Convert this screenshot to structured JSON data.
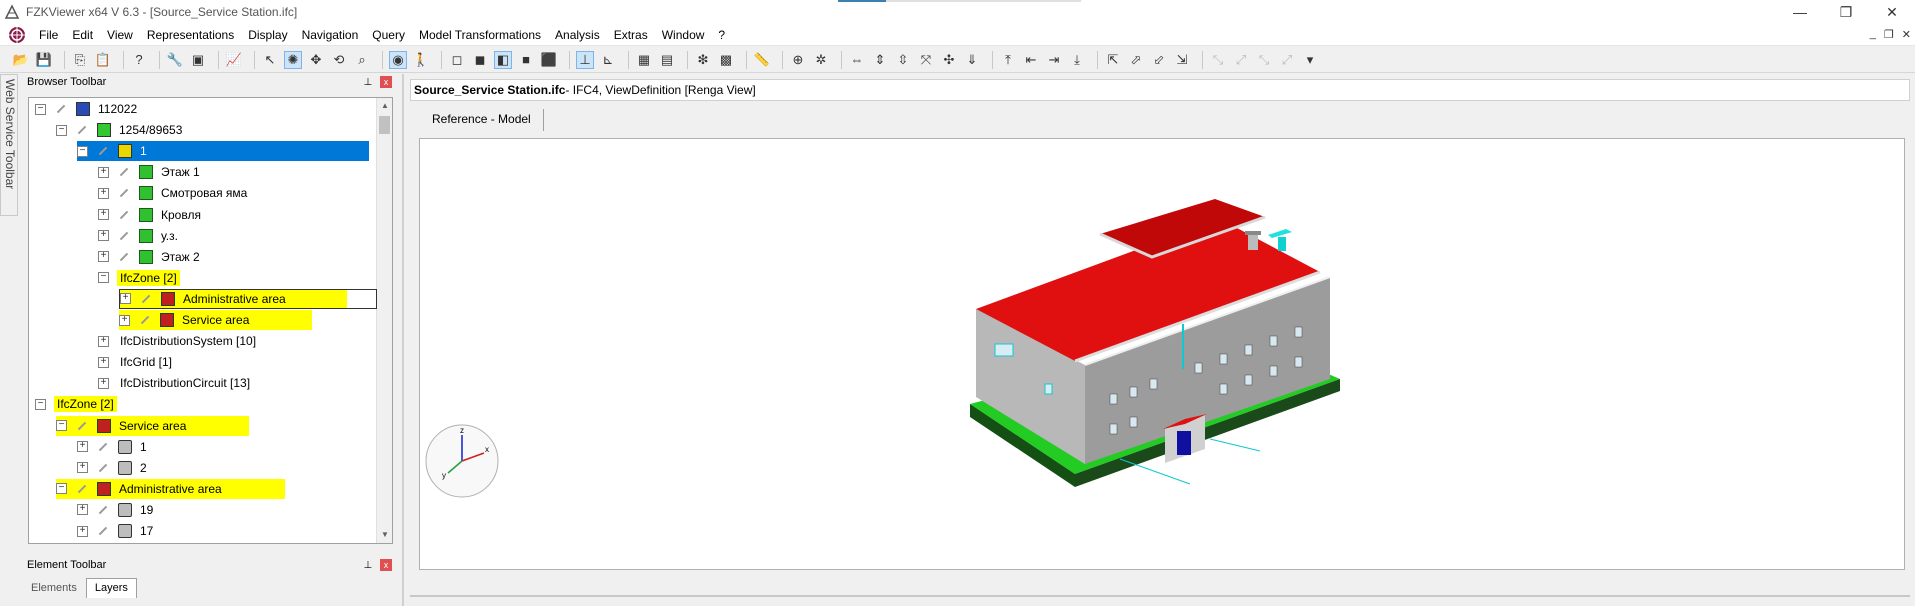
{
  "window": {
    "title": "FZKViewer x64 V 6.3 - [Source_Service Station.ifc]",
    "controls": {
      "minimize": "—",
      "restore": "❐",
      "close": "✕"
    }
  },
  "menu": [
    "File",
    "Edit",
    "View",
    "Representations",
    "Display",
    "Navigation",
    "Query",
    "Model Transformations",
    "Analysis",
    "Extras",
    "Window",
    "?"
  ],
  "mdi_controls": {
    "minimize": "_",
    "restore": "❐",
    "close": "✕"
  },
  "side_tab": {
    "label": "Web Service Toolbar"
  },
  "browser_panel": {
    "title": "Browser Toolbar",
    "pin": "📌",
    "close": "x"
  },
  "tree": {
    "rows": [
      {
        "label": "112022",
        "level": 0,
        "exp": "−",
        "icon": "proj",
        "pencil": true
      },
      {
        "label": "1254/89653",
        "level": 1,
        "exp": "−",
        "icon": "site",
        "pencil": true
      },
      {
        "label": "1",
        "level": 2,
        "exp": "−",
        "icon": "bld",
        "pencil": true,
        "selected": true
      },
      {
        "label": "Этаж 1",
        "level": 3,
        "exp": "+",
        "icon": "story",
        "pencil": true
      },
      {
        "label": "Смотровая яма",
        "level": 3,
        "exp": "+",
        "icon": "story",
        "pencil": true
      },
      {
        "label": "Кровля",
        "level": 3,
        "exp": "+",
        "icon": "story",
        "pencil": true
      },
      {
        "label": "у.з.",
        "level": 3,
        "exp": "+",
        "icon": "story",
        "pencil": true
      },
      {
        "label": "Этаж 2",
        "level": 3,
        "exp": "+",
        "icon": "story",
        "pencil": true
      },
      {
        "label": "IfcZone [2]",
        "level": 3,
        "exp": "−",
        "icon": "",
        "pencil": false,
        "highlight": true
      },
      {
        "label": "Administrative area",
        "level": 4,
        "exp": "+",
        "icon": "zone",
        "pencil": true,
        "highlight": true,
        "boxed": true
      },
      {
        "label": "Service area",
        "level": 4,
        "exp": "+",
        "icon": "zone",
        "pencil": true,
        "highlight": true
      },
      {
        "label": "IfcDistributionSystem [10]",
        "level": 3,
        "exp": "+",
        "icon": "",
        "pencil": false
      },
      {
        "label": "IfcGrid [1]",
        "level": 3,
        "exp": "+",
        "icon": "",
        "pencil": false
      },
      {
        "label": "IfcDistributionCircuit [13]",
        "level": 3,
        "exp": "+",
        "icon": "",
        "pencil": false
      },
      {
        "label": "IfcZone [2]",
        "level": 0,
        "exp": "−",
        "icon": "",
        "pencil": false,
        "highlight": true
      },
      {
        "label": "Service area",
        "level": 1,
        "exp": "−",
        "icon": "zone",
        "pencil": true,
        "highlight": true
      },
      {
        "label": "1",
        "level": 2,
        "exp": "+",
        "icon": "space",
        "pencil": true
      },
      {
        "label": "2",
        "level": 2,
        "exp": "+",
        "icon": "space",
        "pencil": true
      },
      {
        "label": "Administrative area",
        "level": 1,
        "exp": "−",
        "icon": "zone",
        "pencil": true,
        "highlight": true
      },
      {
        "label": "19",
        "level": 2,
        "exp": "+",
        "icon": "space",
        "pencil": true
      },
      {
        "label": "17",
        "level": 2,
        "exp": "+",
        "icon": "space",
        "pencil": true
      }
    ]
  },
  "element_panel": {
    "title": "Element Toolbar",
    "pin": "📌",
    "close": "x"
  },
  "element_tabs": [
    "Elements",
    "Layers"
  ],
  "document": {
    "filename": "Source_Service Station.ifc",
    "info": " - IFC4, ViewDefinition [Renga View]",
    "tab": "Reference - Model"
  },
  "axis_gizmo": {
    "x": "x",
    "y": "y",
    "z": "z"
  },
  "colors": {
    "selection": "#0078d7",
    "highlight": "#ffff00",
    "roof": "#e01010",
    "ground": "#22cc22"
  }
}
